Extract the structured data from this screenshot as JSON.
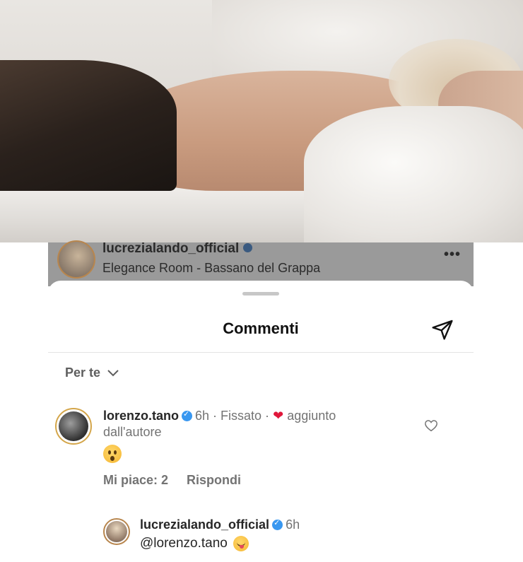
{
  "post": {
    "username": "lucrezialando_official",
    "location": "Elegance Room - Bassano del Grappa",
    "more_label": "•••"
  },
  "comments_sheet": {
    "title": "Commenti",
    "filter_label": "Per te"
  },
  "comment": {
    "username": "lorenzo.tano",
    "time": "6h",
    "pinned_label": "· Fissato ·",
    "liked_by_author_label": "aggiunto",
    "liked_by_author_label_cont": "dall'autore",
    "emoji": "😮",
    "likes_label": "Mi piace: 2",
    "reply_label": "Rispondi"
  },
  "reply": {
    "username": "lucrezialando_official",
    "time": "6h",
    "text": "@lorenzo.tano",
    "emoji": "😋"
  },
  "colors": {
    "verified": "#3897f0",
    "heart": "#e0173b",
    "muted_text": "#737373"
  }
}
